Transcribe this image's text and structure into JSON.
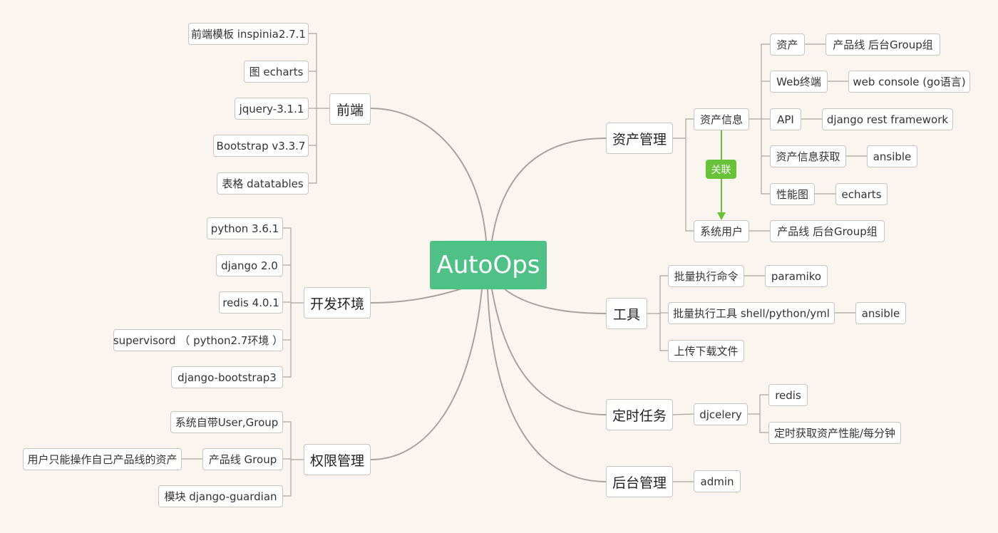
{
  "root": {
    "label": "AutoOps",
    "color": "#4fc187"
  },
  "colors": {
    "link": "#aaa39b",
    "relation": "#67c23a"
  },
  "branches": {
    "frontend": {
      "label": "前端",
      "children": [
        "前端模板 inspinia2.7.1",
        "图 echarts",
        "jquery-3.1.1",
        "Bootstrap v3.3.7",
        "表格 datatables"
      ]
    },
    "devenv": {
      "label": "开发环境",
      "children": [
        "python 3.6.1",
        "django 2.0",
        "redis 4.0.1",
        "supervisord （ python2.7环境 ）",
        "django-bootstrap3"
      ]
    },
    "perm": {
      "label": "权限管理",
      "children": [
        "系统自带User,Group",
        "产品线 Group",
        "模块 django-guardian"
      ],
      "product_note": "用户只能操作自己产品线的资产"
    },
    "asset": {
      "label": "资产管理",
      "info": {
        "label": "资产信息",
        "items": [
          {
            "label": "资产",
            "detail": "产品线  后台Group组"
          },
          {
            "label": "Web终端",
            "detail": "web console (go语言)"
          },
          {
            "label": "API",
            "detail": "django rest framework"
          },
          {
            "label": "资产信息获取",
            "detail": "ansible"
          },
          {
            "label": "性能图",
            "detail": "echarts"
          }
        ]
      },
      "relation_label": "关联",
      "sysuser": {
        "label": "系统用户",
        "detail": "产品线  后台Group组"
      }
    },
    "tools": {
      "label": "工具",
      "items": [
        {
          "label": "批量执行命令",
          "detail": "paramiko"
        },
        {
          "label": "批量执行工具 shell/python/yml",
          "detail": "ansible"
        },
        {
          "label": "上传下载文件"
        }
      ]
    },
    "cron": {
      "label": "定时任务",
      "child": "djcelery",
      "items": [
        "redis",
        "定时获取资产性能/每分钟"
      ]
    },
    "admin": {
      "label": "后台管理",
      "child": "admin"
    }
  }
}
